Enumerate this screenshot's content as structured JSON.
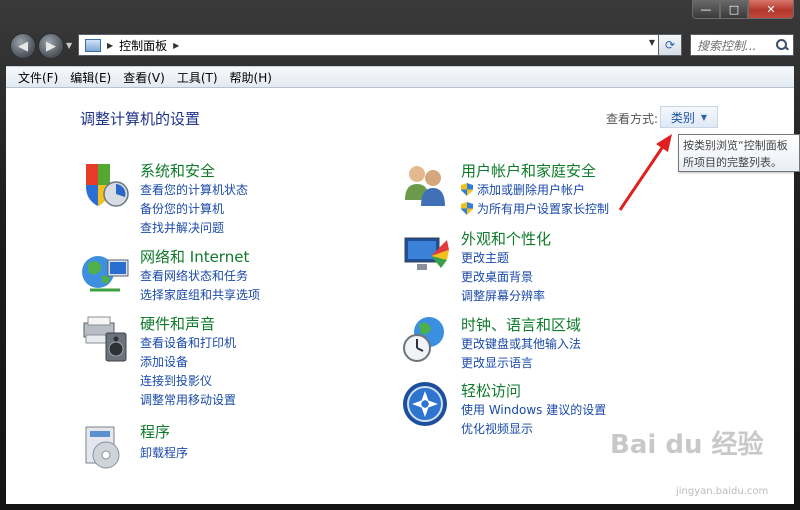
{
  "window": {
    "minimize_glyph": "—",
    "maximize_glyph": "□",
    "close_glyph": "✕"
  },
  "address": {
    "back_glyph": "◀",
    "forward_glyph": "▶",
    "path_separator": "▶",
    "path": "控制面板",
    "refresh_glyph": "⟳",
    "search_placeholder": "搜索控制..."
  },
  "menu": [
    "文件(F)",
    "编辑(E)",
    "查看(V)",
    "工具(T)",
    "帮助(H)"
  ],
  "header": {
    "title": "调整计算机的设置",
    "view_label": "查看方式:",
    "view_value": "类别",
    "tooltip_line1": "按类别浏览“控制面板",
    "tooltip_line2": "所项目的完整列表。"
  },
  "categories_left": [
    {
      "title": "系统和安全",
      "icon": "system-security-icon",
      "links": [
        "查看您的计算机状态",
        "备份您的计算机",
        "查找并解决问题"
      ]
    },
    {
      "title": "网络和 Internet",
      "icon": "network-internet-icon",
      "links": [
        "查看网络状态和任务",
        "选择家庭组和共享选项"
      ]
    },
    {
      "title": "硬件和声音",
      "icon": "hardware-sound-icon",
      "links": [
        "查看设备和打印机",
        "添加设备",
        "连接到投影仪",
        "调整常用移动设置"
      ]
    },
    {
      "title": "程序",
      "icon": "programs-icon",
      "links": [
        "卸载程序"
      ]
    }
  ],
  "categories_right": [
    {
      "title": "用户帐户和家庭安全",
      "icon": "user-accounts-icon",
      "links": [
        "添加或删除用户帐户",
        "为所有用户设置家长控制"
      ]
    },
    {
      "title": "外观和个性化",
      "icon": "appearance-icon",
      "links": [
        "更改主题",
        "更改桌面背景",
        "调整屏幕分辨率"
      ]
    },
    {
      "title": "时钟、语言和区域",
      "icon": "clock-language-icon",
      "links": [
        "更改键盘或其他输入法",
        "更改显示语言"
      ]
    },
    {
      "title": "轻松访问",
      "icon": "ease-of-access-icon",
      "links": [
        "使用 Windows 建议的设置",
        "优化视频显示"
      ]
    }
  ],
  "watermark": {
    "text": "Bai du 经验",
    "sub": "jingyan.baidu.com"
  },
  "colors": {
    "title_green": "#0f7b2a",
    "link_blue": "#1a4aa8",
    "header_blue": "#1e3287",
    "arrow_red": "#e02020"
  }
}
